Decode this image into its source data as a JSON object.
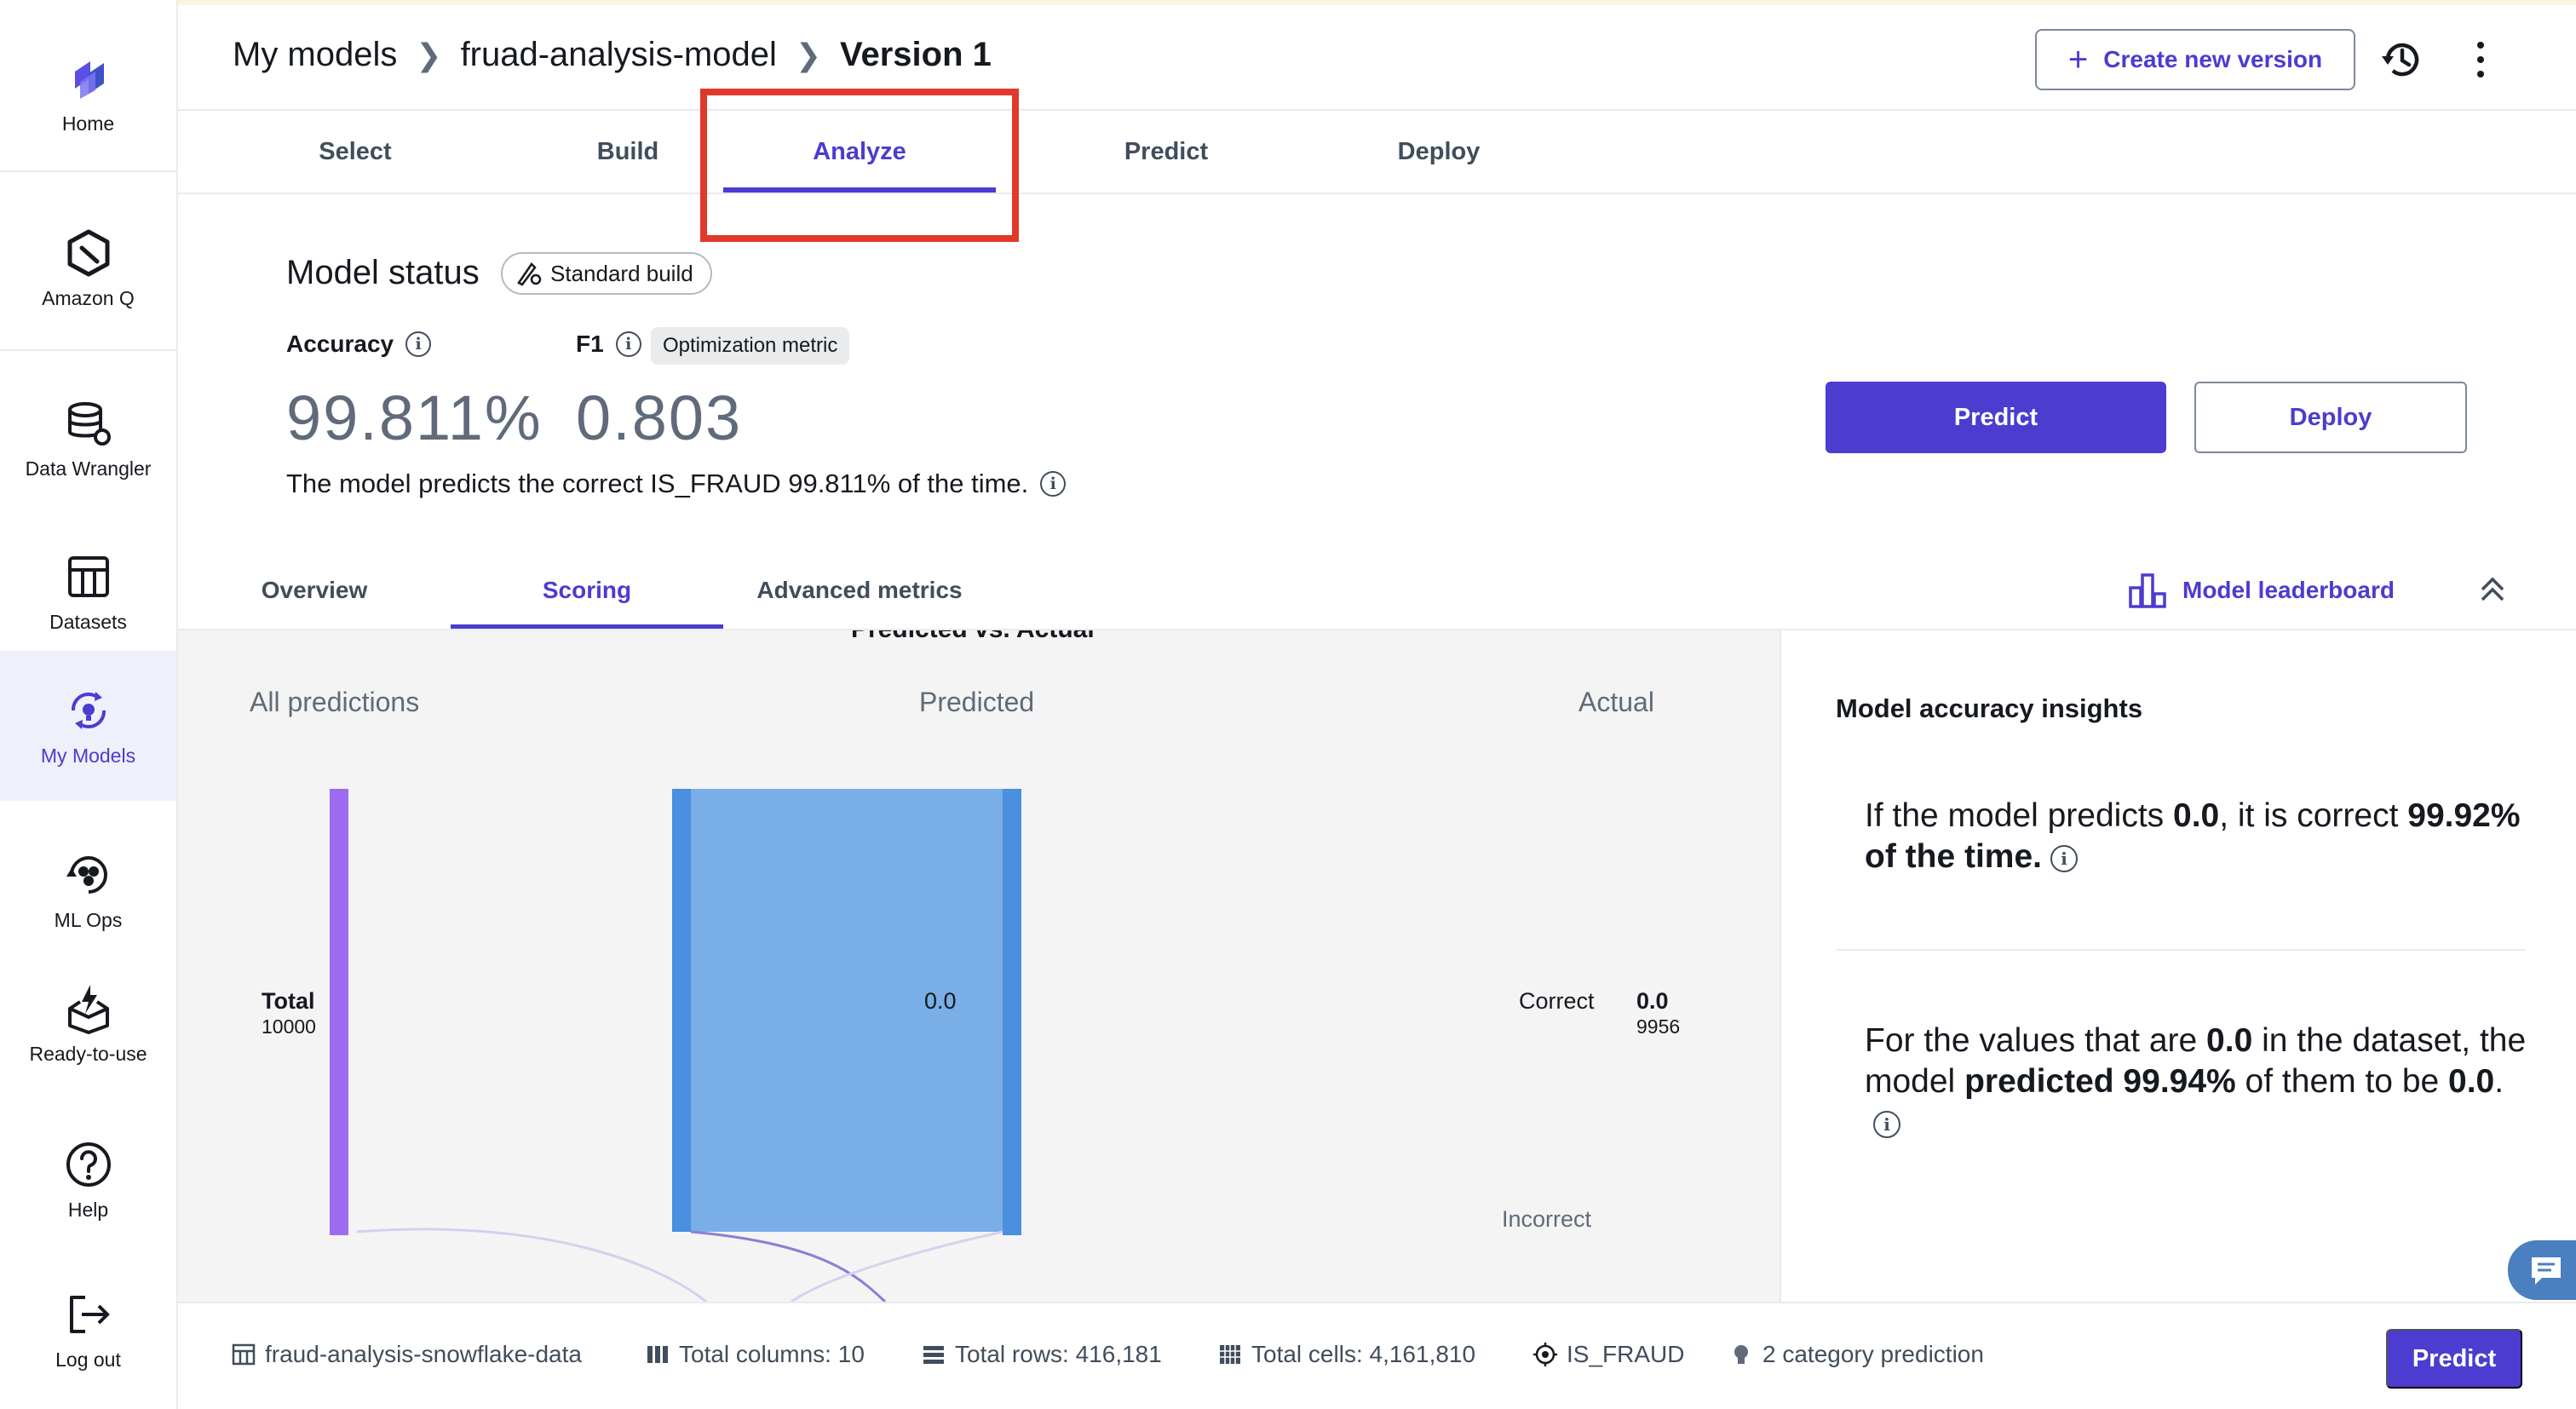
{
  "nav": {
    "items": [
      {
        "label": "Home",
        "icon": "canvas-logo-icon"
      },
      {
        "label": "Amazon Q",
        "icon": "amazon-q-icon"
      },
      {
        "label": "Data Wrangler",
        "icon": "data-wrangler-icon"
      },
      {
        "label": "Datasets",
        "icon": "datasets-icon"
      },
      {
        "label": "My Models",
        "icon": "my-models-icon",
        "active": true
      },
      {
        "label": "ML Ops",
        "icon": "ml-ops-icon"
      },
      {
        "label": "Ready-to-use",
        "icon": "ready-to-use-icon"
      },
      {
        "label": "Help",
        "icon": "help-icon"
      },
      {
        "label": "Log out",
        "icon": "log-out-icon"
      }
    ]
  },
  "header": {
    "breadcrumbs": [
      "My models",
      "fruad-analysis-model",
      "Version 1"
    ],
    "create_version_label": "Create new version"
  },
  "workflow_tabs": [
    "Select",
    "Build",
    "Analyze",
    "Predict",
    "Deploy"
  ],
  "active_workflow_tab": "Analyze",
  "model_status": {
    "title": "Model status",
    "build_type": "Standard build",
    "accuracy_label": "Accuracy",
    "accuracy_value": "99.811%",
    "f1_label": "F1",
    "optimization_badge": "Optimization metric",
    "f1_value": "0.803",
    "description": "The model predicts the correct IS_FRAUD 99.811% of the time.",
    "predict_label": "Predict",
    "deploy_label": "Deploy"
  },
  "sub_tabs": [
    "Overview",
    "Scoring",
    "Advanced metrics"
  ],
  "active_sub_tab": "Scoring",
  "leaderboard_label": "Model leaderboard",
  "chart_data": {
    "type": "sankey",
    "title": "Predicted vs. Actual",
    "columns": [
      "All predictions",
      "Predicted",
      "Actual"
    ],
    "nodes": [
      {
        "column": "All predictions",
        "label": "Total",
        "value": 10000
      },
      {
        "column": "Predicted",
        "label": "0.0"
      },
      {
        "column": "Actual",
        "label": "0.0",
        "value": 9956
      }
    ],
    "link_labels": [
      "Correct",
      "Incorrect"
    ],
    "colors": {
      "gradient_start": "#b79cf7",
      "gradient_end": "#7aaee6",
      "node": "#4a8fe0",
      "total_node": "#9d6bf0"
    }
  },
  "insights": {
    "title": "Model accuracy insights",
    "p1_a": "If the model predicts ",
    "p1_b": "0.0",
    "p1_c": ", it is correct ",
    "p1_d": "99.92% of the time.",
    "p2_a": "For the values that are ",
    "p2_b": "0.0",
    "p2_c": " in the dataset, the model ",
    "p2_d": "predicted 99.94%",
    "p2_e": " of them to be ",
    "p2_f": "0.0",
    "p2_g": "."
  },
  "footer": {
    "dataset": "fraud-analysis-snowflake-data",
    "columns": "Total columns: 10",
    "rows": "Total rows: 416,181",
    "cells": "Total cells: 4,161,810",
    "target": "IS_FRAUD",
    "prediction_type": "2 category prediction",
    "predict_label": "Predict"
  },
  "colors": {
    "accent": "#4c3ccf",
    "highlight_box": "#e0392b"
  }
}
